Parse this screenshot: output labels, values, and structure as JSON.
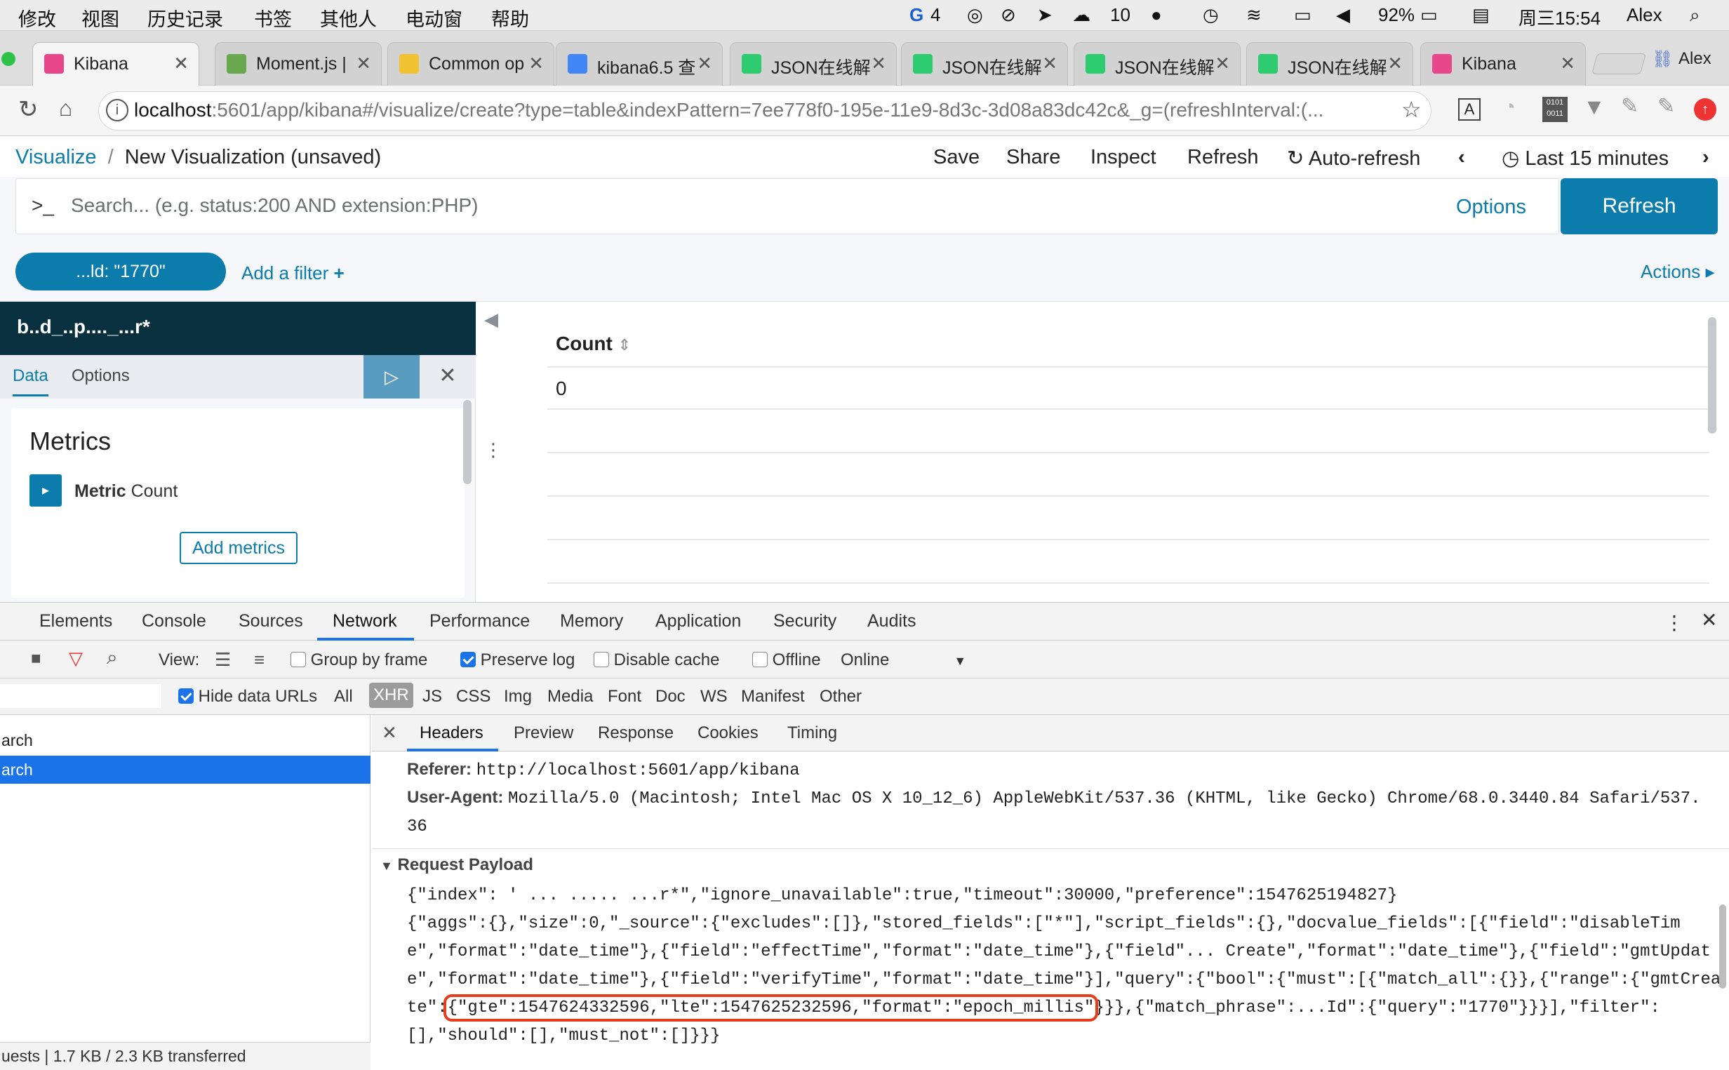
{
  "menubar": {
    "items": [
      "修改",
      "视图",
      "历史记录",
      "书签",
      "其他人",
      "电动窗",
      "帮助"
    ],
    "status": {
      "badge_count": "4",
      "wechat_count": "10",
      "battery": "92%",
      "clock": "周三15:54",
      "user": "Alex"
    }
  },
  "tabs": [
    {
      "title": "Kibana",
      "color": "#e8478b"
    },
    {
      "title": "Moment.js |",
      "color": "#6aa84f"
    },
    {
      "title": "Common op",
      "color": "#f1c232"
    },
    {
      "title": "kibana6.5 查",
      "color": "#4285f4"
    },
    {
      "title": "JSON在线解",
      "color": "#2ecc71"
    },
    {
      "title": "JSON在线解",
      "color": "#2ecc71"
    },
    {
      "title": "JSON在线解",
      "color": "#2ecc71"
    },
    {
      "title": "JSON在线解",
      "color": "#2ecc71"
    },
    {
      "title": "Kibana",
      "color": "#e8478b"
    }
  ],
  "profile_name": "Alex",
  "address": {
    "host": "localhost",
    "rest": ":5601/app/kibana#/visualize/create?type=table&indexPattern=7ee778f0-195e-11e9-8d3c-3d08a83dc42c&_g=(refreshInterval:(..."
  },
  "kibana": {
    "breadcrumb_root": "Visualize",
    "breadcrumb_sep": "/",
    "title": "New Visualization (unsaved)",
    "actions": [
      "Save",
      "Share",
      "Inspect",
      "Refresh"
    ],
    "auto_refresh": "Auto-refresh",
    "time_range": "Last 15 minutes",
    "search_prompt": ">_",
    "search_placeholder": "Search... (e.g. status:200 AND extension:PHP)",
    "options": "Options",
    "refresh_button": "Refresh",
    "filter_pill": "...ld: \"1770\"",
    "add_filter": "Add a filter",
    "actions_menu": "Actions"
  },
  "sidebar": {
    "index_name": "b..d_..p...._...r*",
    "tab_data": "Data",
    "tab_options": "Options",
    "metrics_title": "Metrics",
    "metric_label_bold": "Metric",
    "metric_label": "Count",
    "add_metrics": "Add metrics"
  },
  "table": {
    "header": "Count",
    "value": "0"
  },
  "devtools": {
    "panels": [
      "Elements",
      "Console",
      "Sources",
      "Network",
      "Performance",
      "Memory",
      "Application",
      "Security",
      "Audits"
    ],
    "active_panel": "Network",
    "toolbar": {
      "view": "View:",
      "group_by_frame": "Group by frame",
      "preserve_log": "Preserve log",
      "disable_cache": "Disable cache",
      "offline": "Offline",
      "online": "Online"
    },
    "filter": {
      "hide_data_urls": "Hide data URLs",
      "types": [
        "All",
        "XHR",
        "JS",
        "CSS",
        "Img",
        "Media",
        "Font",
        "Doc",
        "WS",
        "Manifest",
        "Other"
      ],
      "active_type": "XHR"
    },
    "requests": [
      "arch",
      "arch"
    ],
    "summary": "uests | 1.7 KB / 2.3 KB transferred",
    "detail_tabs": [
      "Headers",
      "Preview",
      "Response",
      "Cookies",
      "Timing"
    ],
    "active_detail": "Headers",
    "headers": {
      "referer_key": "Referer:",
      "referer_val": "http://localhost:5601/app/kibana",
      "ua_key": "User-Agent:",
      "ua_val": "Mozilla/5.0 (Macintosh; Intel Mac OS X 10_12_6) AppleWebKit/537.36 (KHTML, like Gecko) Chrome/68.0.3440.84 Safari/537.",
      "ua_cont": "36"
    },
    "payload_title": "Request Payload",
    "payload": [
      "{\"index\": ' ...  ..... ...r*\",\"ignore_unavailable\":true,\"timeout\":30000,\"preference\":1547625194827}",
      "{\"aggs\":{},\"size\":0,\"_source\":{\"excludes\":[]},\"stored_fields\":[\"*\"],\"script_fields\":{},\"docvalue_fields\":[{\"field\":\"disableTim",
      "e\",\"format\":\"date_time\"},{\"field\":\"effectTime\",\"format\":\"date_time\"},{\"field\"... Create\",\"format\":\"date_time\"},{\"field\":\"gmtUpdat",
      "e\",\"format\":\"date_time\"},{\"field\":\"verifyTime\",\"format\":\"date_time\"}],\"query\":{\"bool\":{\"must\":[{\"match_all\":{}},{\"range\":{\"gmtCrea"
    ],
    "payload_line5_pre": "te\":",
    "payload_highlight": "{\"gte\":1547624332596,\"lte\":1547625232596,\"format\":\"epoch_millis\"",
    "payload_line5_post": "}}},{\"match_phrase\":...Id\":{\"query\":\"1770\"}}}],\"filter\":",
    "payload_line6": "[],\"should\":[],\"must_not\":[]}}}"
  }
}
